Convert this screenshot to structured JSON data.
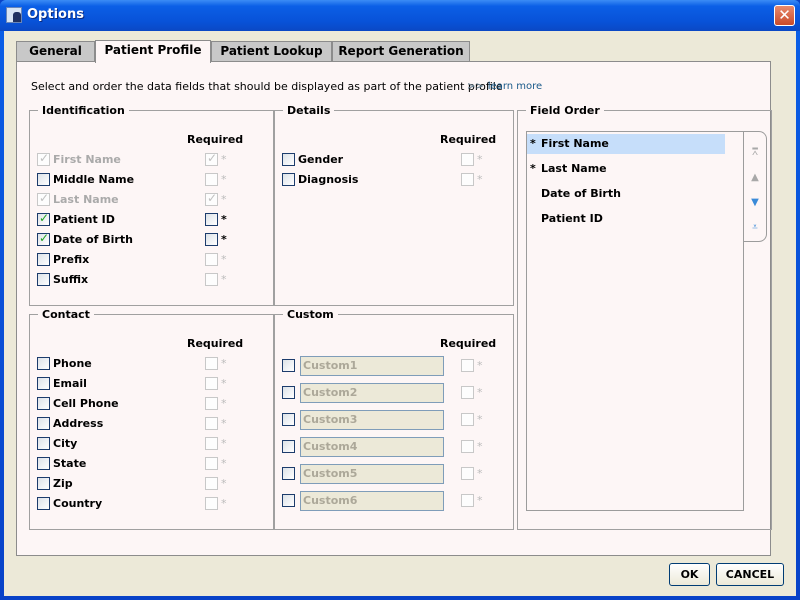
{
  "window": {
    "title": "Options",
    "close_icon": "close-icon"
  },
  "tabs": [
    {
      "label": "General",
      "active": false
    },
    {
      "label": "Patient Profile",
      "active": true
    },
    {
      "label": "Patient Lookup",
      "active": false
    },
    {
      "label": "Report Generation",
      "active": false
    }
  ],
  "intro": "Select and order the data fields that should be displayed as part of the patient profile",
  "learn_more": {
    "arrow": ">>",
    "label": "learn more"
  },
  "required_label": "Required",
  "required_mark": "*",
  "identification": {
    "title": "Identification",
    "fields": [
      {
        "label": "First Name",
        "checked": true,
        "disabled": true,
        "required": true,
        "required_disabled": true
      },
      {
        "label": "Middle Name",
        "checked": false,
        "disabled": false,
        "required": false,
        "required_disabled": true
      },
      {
        "label": "Last Name",
        "checked": true,
        "disabled": true,
        "required": true,
        "required_disabled": true
      },
      {
        "label": "Patient ID",
        "checked": true,
        "disabled": false,
        "required": false,
        "required_disabled": false
      },
      {
        "label": "Date of Birth",
        "checked": true,
        "disabled": false,
        "required": false,
        "required_disabled": false
      },
      {
        "label": "Prefix",
        "checked": false,
        "disabled": false,
        "required": false,
        "required_disabled": true
      },
      {
        "label": "Suffix",
        "checked": false,
        "disabled": false,
        "required": false,
        "required_disabled": true
      }
    ]
  },
  "details": {
    "title": "Details",
    "fields": [
      {
        "label": "Gender",
        "checked": false,
        "disabled": false,
        "required": false,
        "required_disabled": true
      },
      {
        "label": "Diagnosis",
        "checked": false,
        "disabled": false,
        "required": false,
        "required_disabled": true
      }
    ]
  },
  "contact": {
    "title": "Contact",
    "fields": [
      {
        "label": "Phone"
      },
      {
        "label": "Email"
      },
      {
        "label": "Cell Phone"
      },
      {
        "label": "Address"
      },
      {
        "label": "City"
      },
      {
        "label": "State"
      },
      {
        "label": "Zip"
      },
      {
        "label": "Country"
      }
    ]
  },
  "custom": {
    "title": "Custom",
    "fields": [
      {
        "placeholder": "Custom1"
      },
      {
        "placeholder": "Custom2"
      },
      {
        "placeholder": "Custom3"
      },
      {
        "placeholder": "Custom4"
      },
      {
        "placeholder": "Custom5"
      },
      {
        "placeholder": "Custom6"
      }
    ]
  },
  "field_order": {
    "title": "Field Order",
    "items": [
      {
        "label": "First Name",
        "required": true,
        "selected": true
      },
      {
        "label": "Last Name",
        "required": true,
        "selected": false
      },
      {
        "label": "Date of Birth",
        "required": false,
        "selected": false
      },
      {
        "label": "Patient ID",
        "required": false,
        "selected": false
      }
    ],
    "buttons": [
      {
        "name": "move-to-top",
        "icon": "⩞",
        "enabled": false
      },
      {
        "name": "move-up",
        "icon": "▲",
        "enabled": false
      },
      {
        "name": "move-down",
        "icon": "▼",
        "enabled": true
      },
      {
        "name": "move-to-bottom",
        "icon": "⩡",
        "enabled": true
      }
    ]
  },
  "buttons": {
    "ok": "OK",
    "cancel": "CANCEL"
  }
}
